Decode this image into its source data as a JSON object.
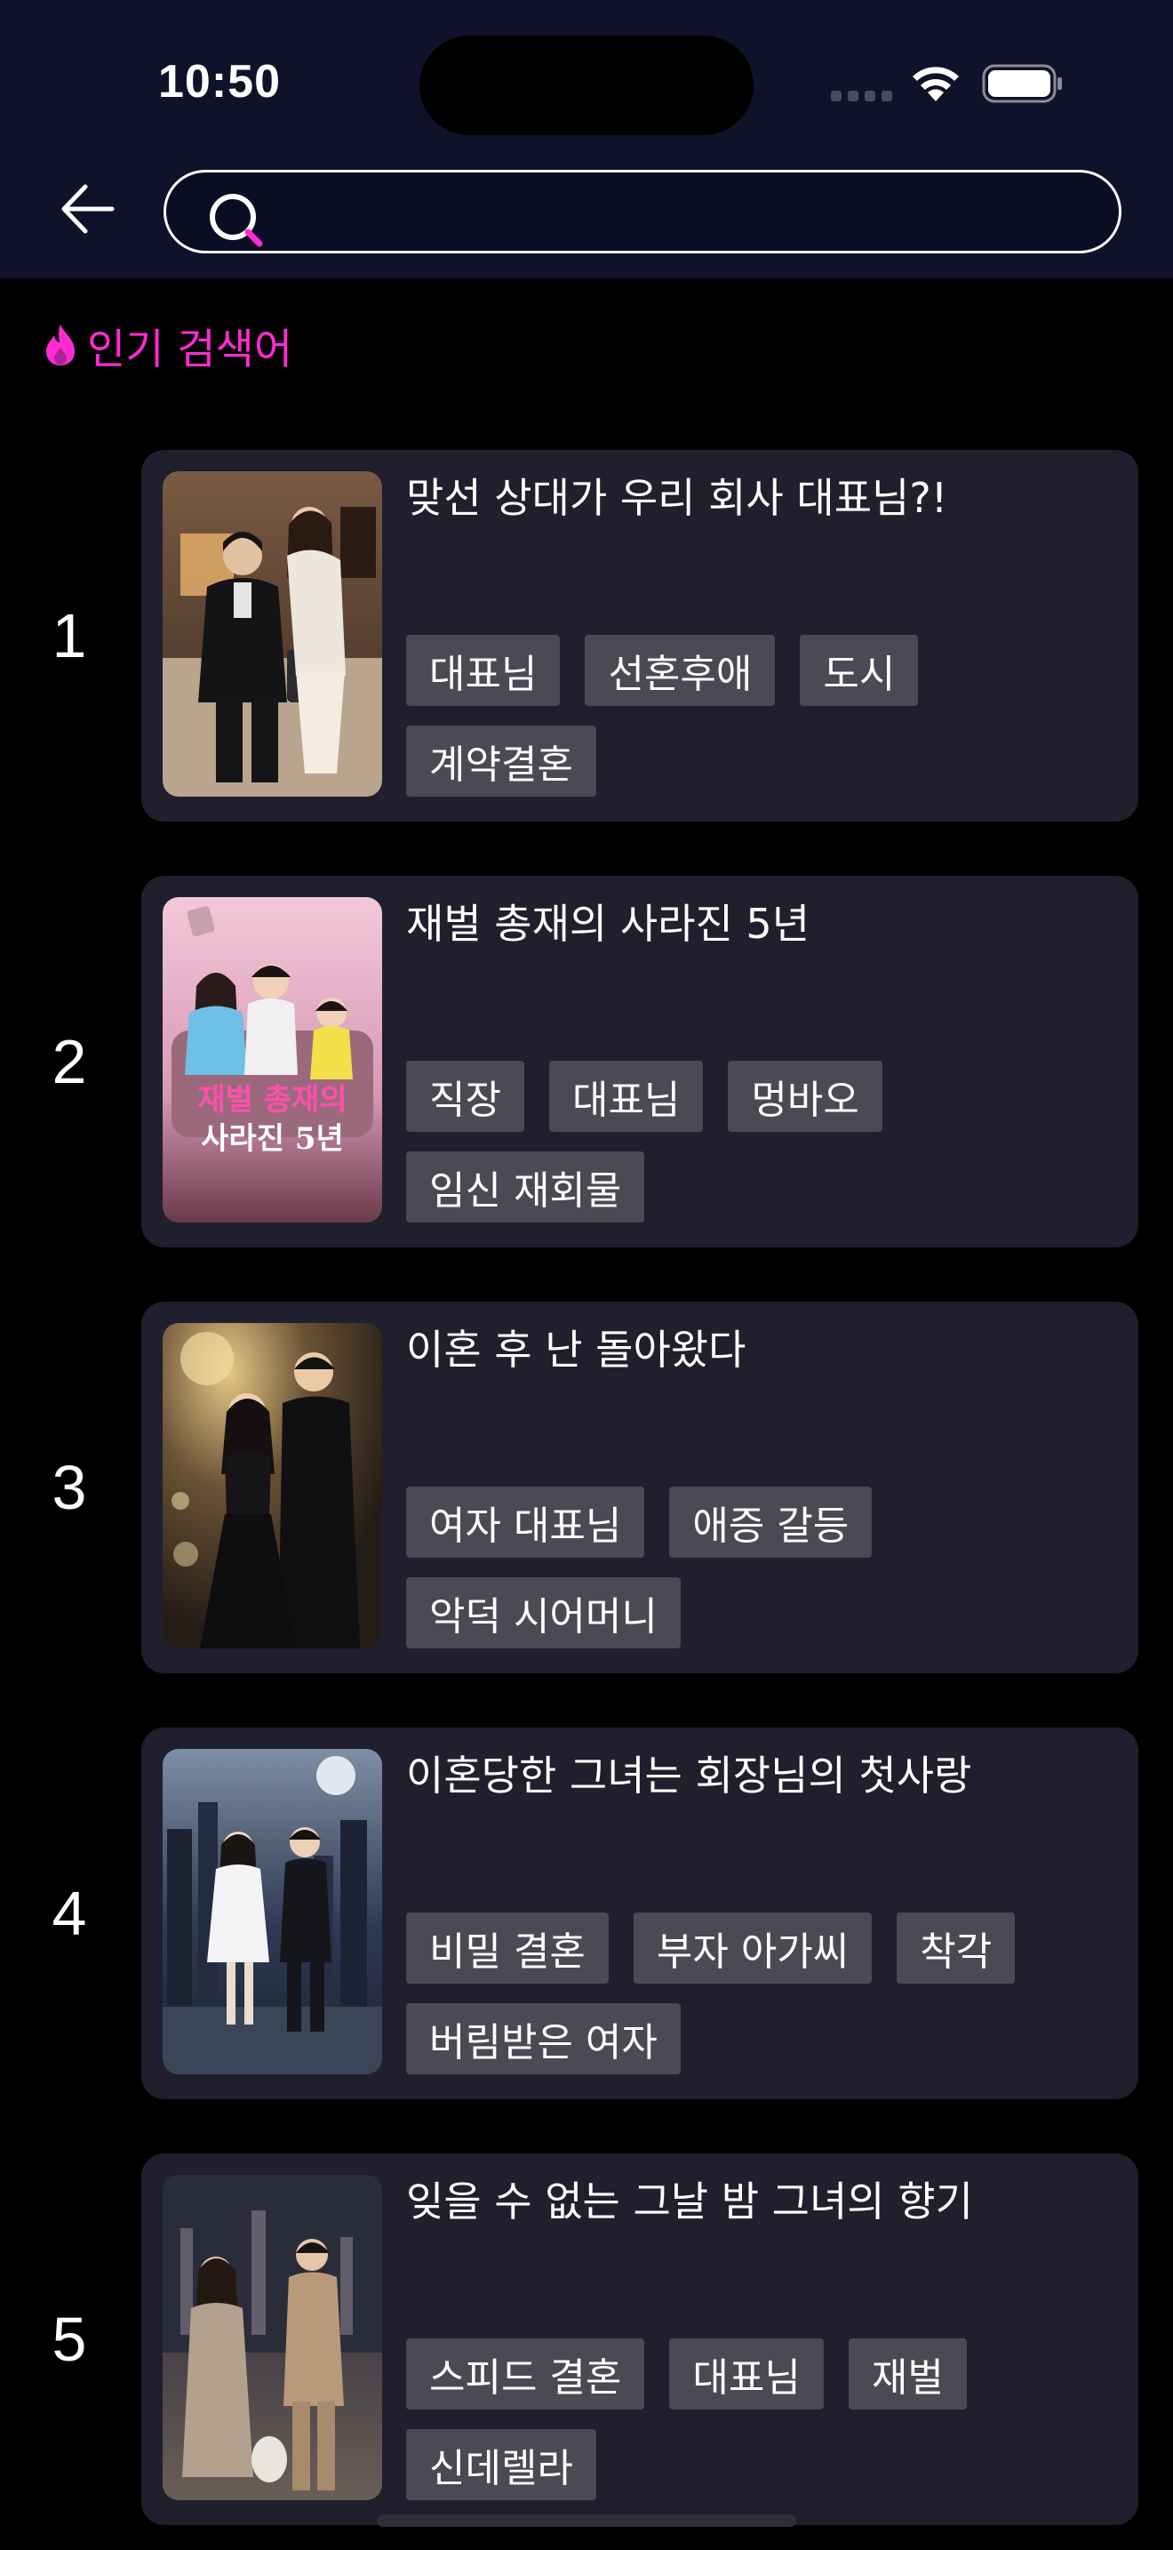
{
  "status_bar": {
    "time": "10:50"
  },
  "search": {
    "placeholder": "",
    "value": ""
  },
  "section": {
    "title": "인기 검색어"
  },
  "items": [
    {
      "rank": "1",
      "title": "맞선 상대가 우리 회사 대표님?!",
      "tags": [
        "대표님",
        "선혼후애",
        "도시",
        "계약결혼"
      ]
    },
    {
      "rank": "2",
      "title": "재벌 총재의 사라진 5년",
      "tags": [
        "직장",
        "대표님",
        "멍바오",
        "임신 재회물"
      ],
      "poster_text": [
        "재벌 총재의",
        "사라진 5년"
      ]
    },
    {
      "rank": "3",
      "title": "이혼 후 난 돌아왔다",
      "tags": [
        "여자 대표님",
        "애증 갈등",
        "악덕 시어머니"
      ]
    },
    {
      "rank": "4",
      "title": "이혼당한 그녀는 회장님의 첫사랑",
      "tags": [
        "비밀 결혼",
        "부자 아가씨",
        "착각",
        "버림받은 여자"
      ]
    },
    {
      "rank": "5",
      "title": "잊을 수 없는 그날 밤 그녀의 향기",
      "tags": [
        "스피드 결혼",
        "대표님",
        "재벌",
        "신데렐라"
      ]
    }
  ],
  "colors": {
    "accent": "#ff2bd1",
    "top_bar": "#10122a",
    "card": "#1f1f2d",
    "tag": "#4a4a55",
    "background": "#000000"
  },
  "icons": {
    "back": "arrow-left-icon",
    "search": "search-icon",
    "popular": "fire-icon",
    "wifi": "wifi-icon",
    "battery": "battery-icon"
  }
}
